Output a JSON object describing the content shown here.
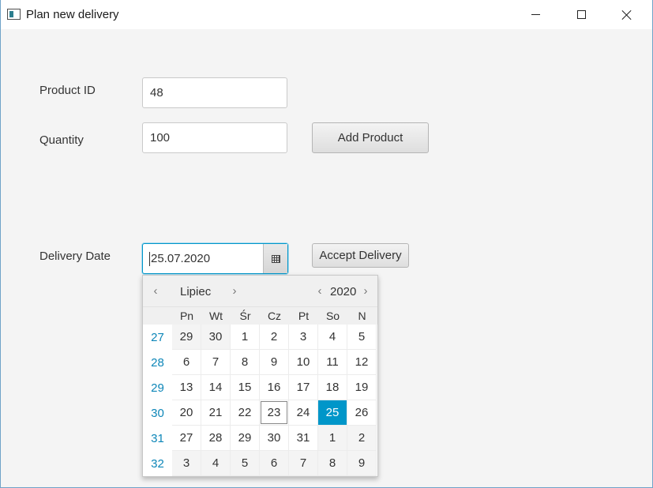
{
  "window": {
    "title": "Plan new delivery"
  },
  "form": {
    "product_id_label": "Product ID",
    "product_id_value": "48",
    "quantity_label": "Quantity",
    "quantity_value": "100",
    "add_product_label": "Add Product",
    "delivery_date_label": "Delivery Date",
    "delivery_date_value": "25.07.2020",
    "accept_delivery_label": "Accept Delivery"
  },
  "calendar": {
    "month": "Lipiec",
    "year": "2020",
    "prev_glyph": "‹",
    "next_glyph": "›",
    "weekdays": [
      "Pn",
      "Wt",
      "Śr",
      "Cz",
      "Pt",
      "So",
      "N"
    ],
    "weeks": [
      {
        "num": "27",
        "days": [
          "29",
          "30",
          "1",
          "2",
          "3",
          "4",
          "5"
        ]
      },
      {
        "num": "28",
        "days": [
          "6",
          "7",
          "8",
          "9",
          "10",
          "11",
          "12"
        ]
      },
      {
        "num": "29",
        "days": [
          "13",
          "14",
          "15",
          "16",
          "17",
          "18",
          "19"
        ]
      },
      {
        "num": "30",
        "days": [
          "20",
          "21",
          "22",
          "23",
          "24",
          "25",
          "26"
        ]
      },
      {
        "num": "31",
        "days": [
          "27",
          "28",
          "29",
          "30",
          "31",
          "1",
          "2"
        ]
      },
      {
        "num": "32",
        "days": [
          "3",
          "4",
          "5",
          "6",
          "7",
          "8",
          "9"
        ]
      }
    ],
    "today": "23",
    "selected": "25",
    "accent_color": "#0096c9",
    "week_number_color": "#0d86b8"
  }
}
